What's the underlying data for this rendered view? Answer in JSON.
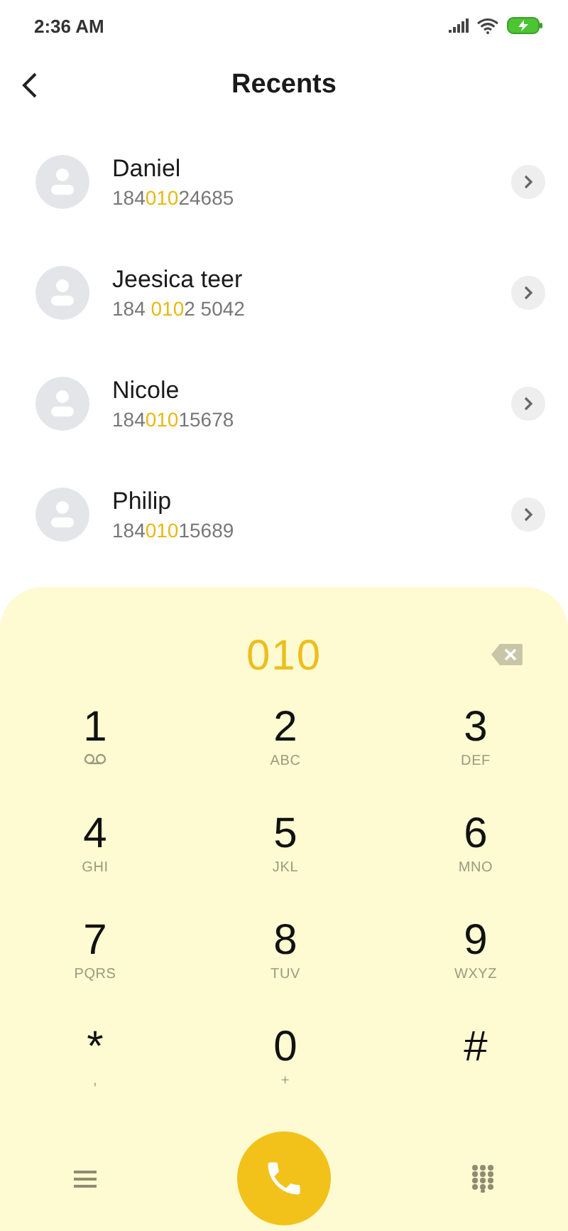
{
  "status_bar": {
    "time": "2:36 AM"
  },
  "header": {
    "title": "Recents"
  },
  "contacts": [
    {
      "name": "Daniel",
      "number": [
        {
          "text": "184",
          "match": false
        },
        {
          "text": "010",
          "match": true
        },
        {
          "text": "24685",
          "match": false
        }
      ]
    },
    {
      "name": "Jeesica teer",
      "number": [
        {
          "text": "184 ",
          "match": false
        },
        {
          "text": "010",
          "match": true
        },
        {
          "text": "2 5042",
          "match": false
        }
      ]
    },
    {
      "name": "Nicole",
      "number": [
        {
          "text": "184",
          "match": false
        },
        {
          "text": "010",
          "match": true
        },
        {
          "text": "15678",
          "match": false
        }
      ]
    },
    {
      "name": "Philip",
      "number": [
        {
          "text": "184",
          "match": false
        },
        {
          "text": "010",
          "match": true
        },
        {
          "text": "15689",
          "match": false
        }
      ]
    }
  ],
  "dialpad": {
    "entered": "010",
    "keys": [
      {
        "digit": "1",
        "kind": "voicemail"
      },
      {
        "digit": "2",
        "kind": "letters",
        "sub": "ABC"
      },
      {
        "digit": "3",
        "kind": "letters",
        "sub": "DEF"
      },
      {
        "digit": "4",
        "kind": "letters",
        "sub": "GHI"
      },
      {
        "digit": "5",
        "kind": "letters",
        "sub": "JKL"
      },
      {
        "digit": "6",
        "kind": "letters",
        "sub": "MNO"
      },
      {
        "digit": "7",
        "kind": "letters",
        "sub": "PQRS"
      },
      {
        "digit": "8",
        "kind": "letters",
        "sub": "TUV"
      },
      {
        "digit": "9",
        "kind": "letters",
        "sub": "WXYZ"
      },
      {
        "digit": "*",
        "kind": "letters",
        "sub": ","
      },
      {
        "digit": "0",
        "kind": "letters",
        "sub": "+"
      },
      {
        "digit": "#",
        "kind": "plain"
      }
    ]
  }
}
